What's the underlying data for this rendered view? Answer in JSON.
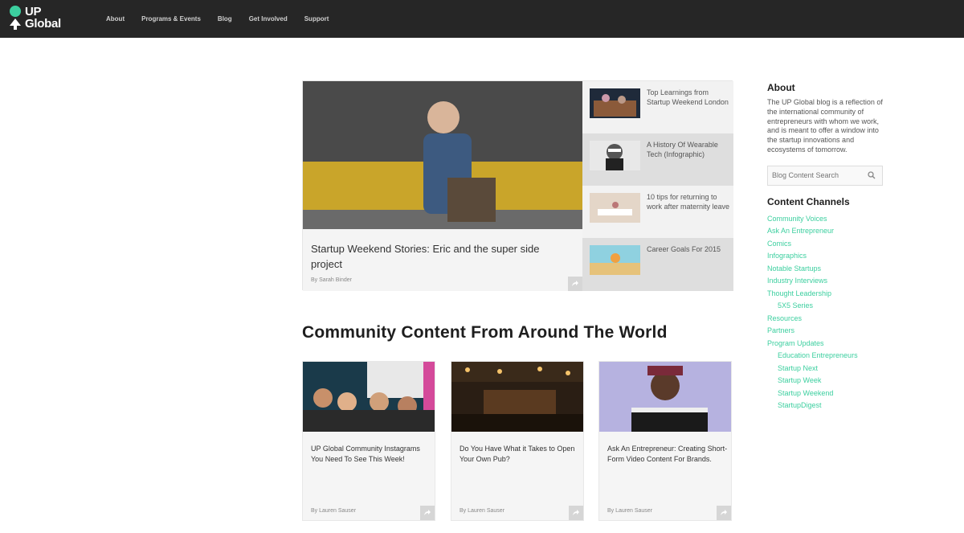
{
  "brand": {
    "logo_line1": "UP",
    "logo_line2": "Global",
    "accent": "#3ccf9f"
  },
  "nav": {
    "items": [
      "About",
      "Programs & Events",
      "Blog",
      "Get Involved",
      "Support"
    ]
  },
  "hero": {
    "title": "Startup Weekend Stories: Eric and the super side project",
    "byline": "By Sarah Binder"
  },
  "side_posts": [
    {
      "title": "Top Learnings from Startup Weekend London"
    },
    {
      "title": "A History Of Wearable Tech (Infographic)"
    },
    {
      "title": "10 tips for returning to work after maternity leave"
    },
    {
      "title": "Career Goals For 2015"
    }
  ],
  "community": {
    "heading": "Community Content From Around The World",
    "cards": [
      {
        "title": "UP Global Community Instagrams You Need To See This Week!",
        "byline": "By Lauren Sauser"
      },
      {
        "title": "Do You Have What it Takes to Open Your Own Pub?",
        "byline": "By Lauren Sauser"
      },
      {
        "title": "Ask An Entrepreneur: Creating Short-Form Video Content For Brands.",
        "byline": "By Lauren Sauser"
      }
    ]
  },
  "sidebar": {
    "about_heading": "About",
    "about_text": "The UP Global blog is a reflection of the international community of entrepreneurs with whom we work, and is meant to offer a window into the startup innovations and ecosystems of tomorrow.",
    "search_placeholder": "Blog Content Search",
    "channels_heading": "Content Channels",
    "channels": [
      {
        "label": "Community Voices",
        "sub": false
      },
      {
        "label": "Ask An Entrepreneur",
        "sub": false
      },
      {
        "label": "Comics",
        "sub": false
      },
      {
        "label": "Infographics",
        "sub": false
      },
      {
        "label": "Notable Startups",
        "sub": false
      },
      {
        "label": "Industry Interviews",
        "sub": false
      },
      {
        "label": "Thought Leadership",
        "sub": false
      },
      {
        "label": "5X5 Series",
        "sub": true
      },
      {
        "label": "Resources",
        "sub": false
      },
      {
        "label": "Partners",
        "sub": false
      },
      {
        "label": "Program Updates",
        "sub": false
      },
      {
        "label": "Education Entrepreneurs",
        "sub": true
      },
      {
        "label": "Startup Next",
        "sub": true
      },
      {
        "label": "Startup Week",
        "sub": true
      },
      {
        "label": "Startup Weekend",
        "sub": true
      },
      {
        "label": "StartupDigest",
        "sub": true
      }
    ]
  }
}
